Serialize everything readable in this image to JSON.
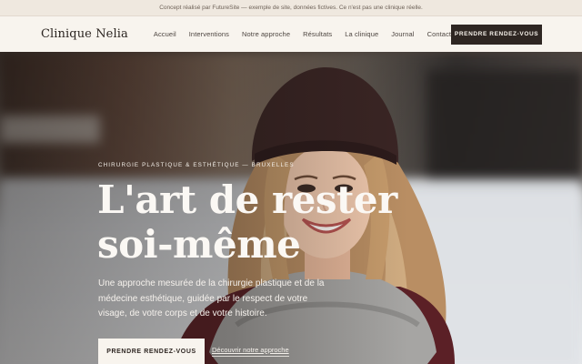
{
  "notice": {
    "text": "Concept réalisé par FutureSite — exemple de site, données fictives. Ce n'est pas une clinique réelle."
  },
  "header": {
    "brand": "Clinique Nelia",
    "nav": [
      "Accueil",
      "Interventions",
      "Notre approche",
      "Résultats",
      "La clinique",
      "Journal",
      "Contact"
    ],
    "cta": "PRENDRE RENDEZ-VOUS"
  },
  "hero": {
    "eyebrow": "CHIRURGIE PLASTIQUE & ESTHÉTIQUE — BRUXELLES",
    "headline": "L'art de rester soi-même",
    "lede": "Une approche mesurée de la chirurgie plastique et de la médecine esthétique, guidée par le respect de votre visage, de votre corps et de votre histoire.",
    "primary_cta": "PRENDRE RENDEZ-VOUS",
    "secondary_link": "Découvrir notre approche"
  },
  "colors": {
    "notice_bg": "#efe8df",
    "header_bg": "#f8f4ee",
    "dark": "#2e2622",
    "hero_text": "#fbf8f4"
  }
}
